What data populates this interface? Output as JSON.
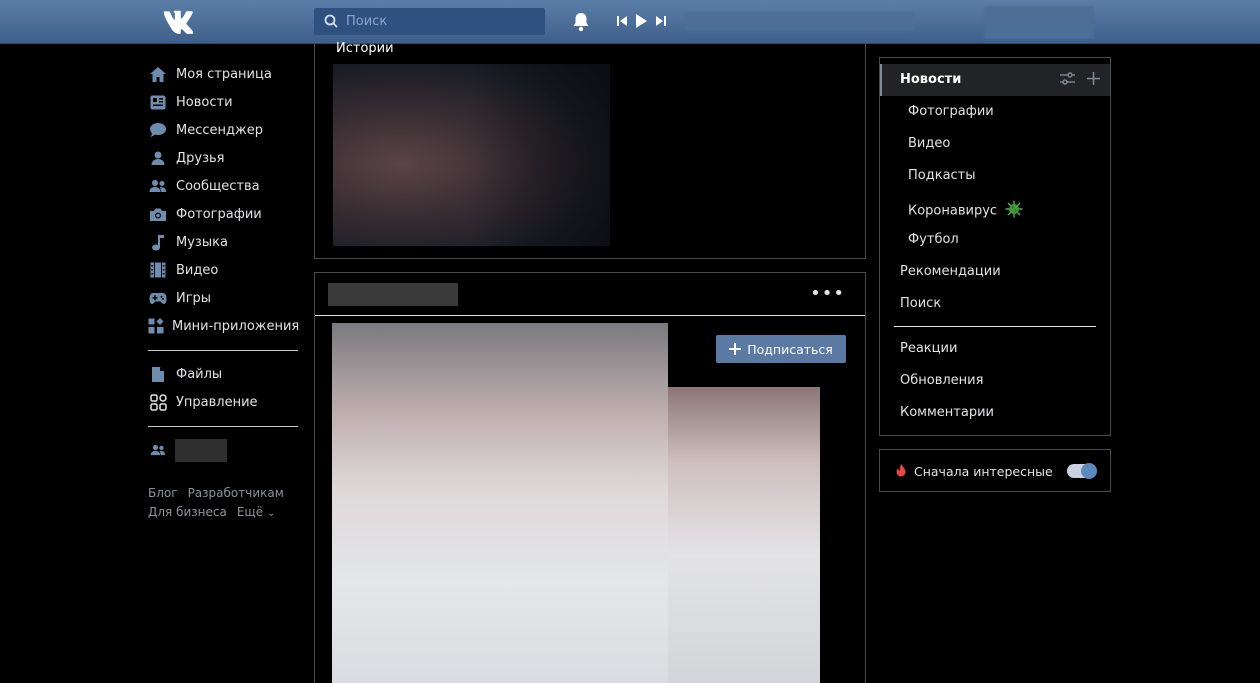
{
  "header": {
    "search_placeholder": "Поиск"
  },
  "nav": {
    "items": [
      {
        "label": "Моя страница",
        "icon": "home-icon"
      },
      {
        "label": "Новости",
        "icon": "news-icon"
      },
      {
        "label": "Мессенджер",
        "icon": "messenger-icon"
      },
      {
        "label": "Друзья",
        "icon": "friends-icon"
      },
      {
        "label": "Сообщества",
        "icon": "communities-icon"
      },
      {
        "label": "Фотографии",
        "icon": "camera-icon"
      },
      {
        "label": "Музыка",
        "icon": "music-icon"
      },
      {
        "label": "Видео",
        "icon": "video-icon"
      },
      {
        "label": "Игры",
        "icon": "gamepad-icon"
      },
      {
        "label": "Мини-приложения",
        "icon": "apps-icon"
      }
    ],
    "secondary": [
      {
        "label": "Файлы",
        "icon": "file-icon"
      },
      {
        "label": "Управление",
        "icon": "manage-icon"
      }
    ]
  },
  "footer": {
    "links": [
      "Блог",
      "Разработчикам",
      "Для бизнеса",
      "Ещё"
    ]
  },
  "stories": {
    "title": "Истории"
  },
  "post": {
    "more": "•••",
    "subscribe_label": "Подписаться"
  },
  "right_menu": {
    "active": "Новости",
    "sub_items": [
      "Фотографии",
      "Видео",
      "Подкасты",
      "Коронавирус",
      "Футбол"
    ],
    "items": [
      "Рекомендации",
      "Поиск"
    ],
    "items2": [
      "Реакции",
      "Обновления",
      "Комментарии"
    ]
  },
  "interesting": {
    "label": "Сначала интересные",
    "enabled": true
  },
  "colors": {
    "header": "#4a6d97",
    "accent": "#5b7aa3",
    "background": "#000000"
  }
}
